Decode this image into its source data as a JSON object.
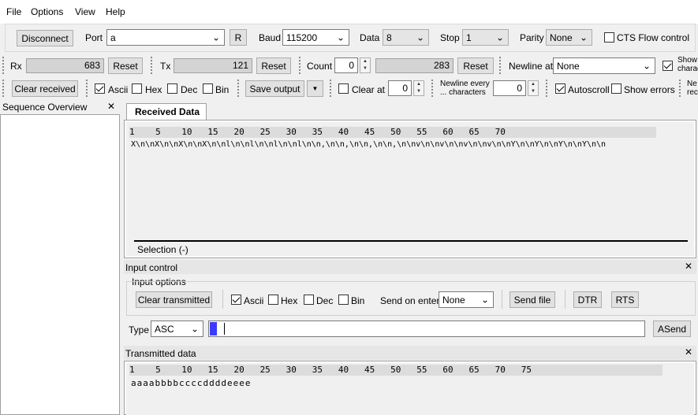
{
  "menu": [
    "File",
    "Options",
    "View",
    "Help"
  ],
  "connection": {
    "disconnect_label": "Disconnect",
    "port_label": "Port",
    "port_value": "a",
    "refresh_label": "R",
    "baud_label": "Baud",
    "baud_value": "115200",
    "data_label": "Data",
    "data_value": "8",
    "stop_label": "Stop",
    "stop_value": "1",
    "parity_label": "Parity",
    "parity_value": "None",
    "cts_label": "CTS Flow control"
  },
  "counters": {
    "rx_label": "Rx",
    "rx_value": "683",
    "rx_reset": "Reset",
    "tx_label": "Tx",
    "tx_value": "121",
    "tx_reset": "Reset",
    "count_label": "Count",
    "count_value": "0",
    "count_total": "283",
    "count_reset": "Reset",
    "newline_at_label": "Newline at",
    "newline_at_value": "None",
    "show_chars_label_1": "Show",
    "show_chars_label_2": "charac"
  },
  "display": {
    "clear_received": "Clear received",
    "ascii_label": "Ascii",
    "hex_label": "Hex",
    "dec_label": "Dec",
    "bin_label": "Bin",
    "save_output": "Save output",
    "clear_at_label": "Clear at",
    "clear_at_value": "0",
    "newline_every_1": "Newline every",
    "newline_every_2": "... characters",
    "newline_every_value": "0",
    "autoscroll_label": "Autoscroll",
    "show_errors_label": "Show errors",
    "ne_label_1": "Ne",
    "ne_label_2": "rec"
  },
  "sequence": {
    "title": "Sequence Overview",
    "close": "✕"
  },
  "received": {
    "tab": "Received Data",
    "ruler": "1    5    10   15   20   25   30   35   40   45   50   55   60   65   70",
    "content": "X\\n\\nX\\n\\nX\\n\\nX\\n\\nl\\n\\nl\\n\\nl\\n\\nl\\n\\n,\\n\\n,\\n\\n,\\n\\n,\\n\\nv\\n\\nv\\n\\nv\\n\\nv\\n\\nY\\n\\nY\\n\\nY\\n\\nY\\n\\n",
    "selection": "Selection (-)"
  },
  "input_control": {
    "title": "Input control",
    "options_label": "Input options",
    "clear_transmitted": "Clear transmitted",
    "ascii_label": "Ascii",
    "hex_label": "Hex",
    "dec_label": "Dec",
    "bin_label": "Bin",
    "send_on_enter_label": "Send on enter",
    "send_on_enter_value": "None",
    "send_file": "Send file",
    "dtr": "DTR",
    "rts": "RTS",
    "type_label": "Type",
    "type_value": "ASC",
    "send_label": "ASend"
  },
  "transmitted": {
    "title": "Transmitted data",
    "ruler": "1    5    10   15   20   25   30   35   40   45   50   55   60   65   70   75",
    "content": "aaaabbbbccccddddeeee"
  }
}
